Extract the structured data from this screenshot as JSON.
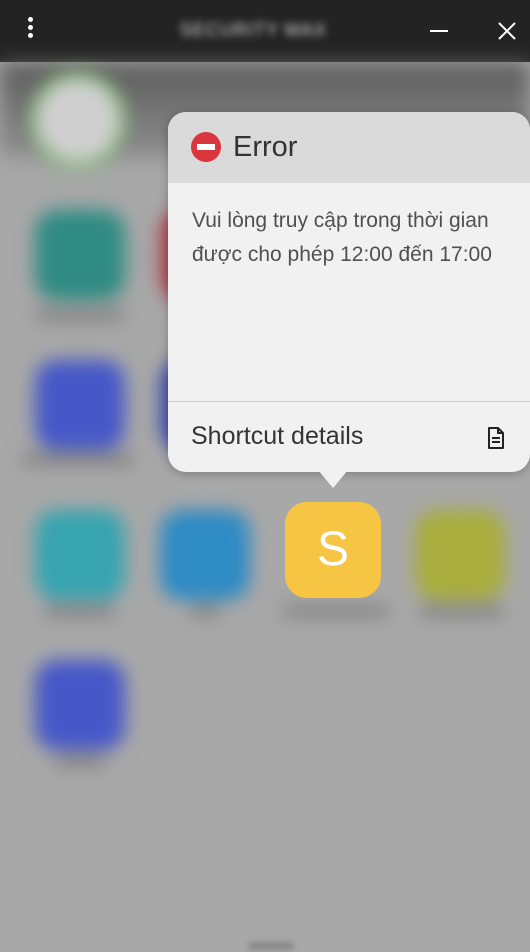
{
  "window": {
    "title": "SECURITY MAX",
    "menu_icon": "more-vert-icon",
    "minimize_icon": "minimize-icon",
    "close_icon": "close-icon"
  },
  "focused_app": {
    "letter": "S",
    "color": "#f6c544"
  },
  "popup": {
    "title": "Error",
    "icon": "no-entry-icon",
    "message": "Vui lòng truy cập trong thời gian được cho phép 12:00 đến 17:00",
    "details_label": "Shortcut details",
    "details_icon": "document-icon"
  },
  "colors": {
    "error_red": "#d9363e",
    "popup_header_bg": "#dadada",
    "popup_bg": "#f1f1f1",
    "title_bar": "#232323"
  }
}
